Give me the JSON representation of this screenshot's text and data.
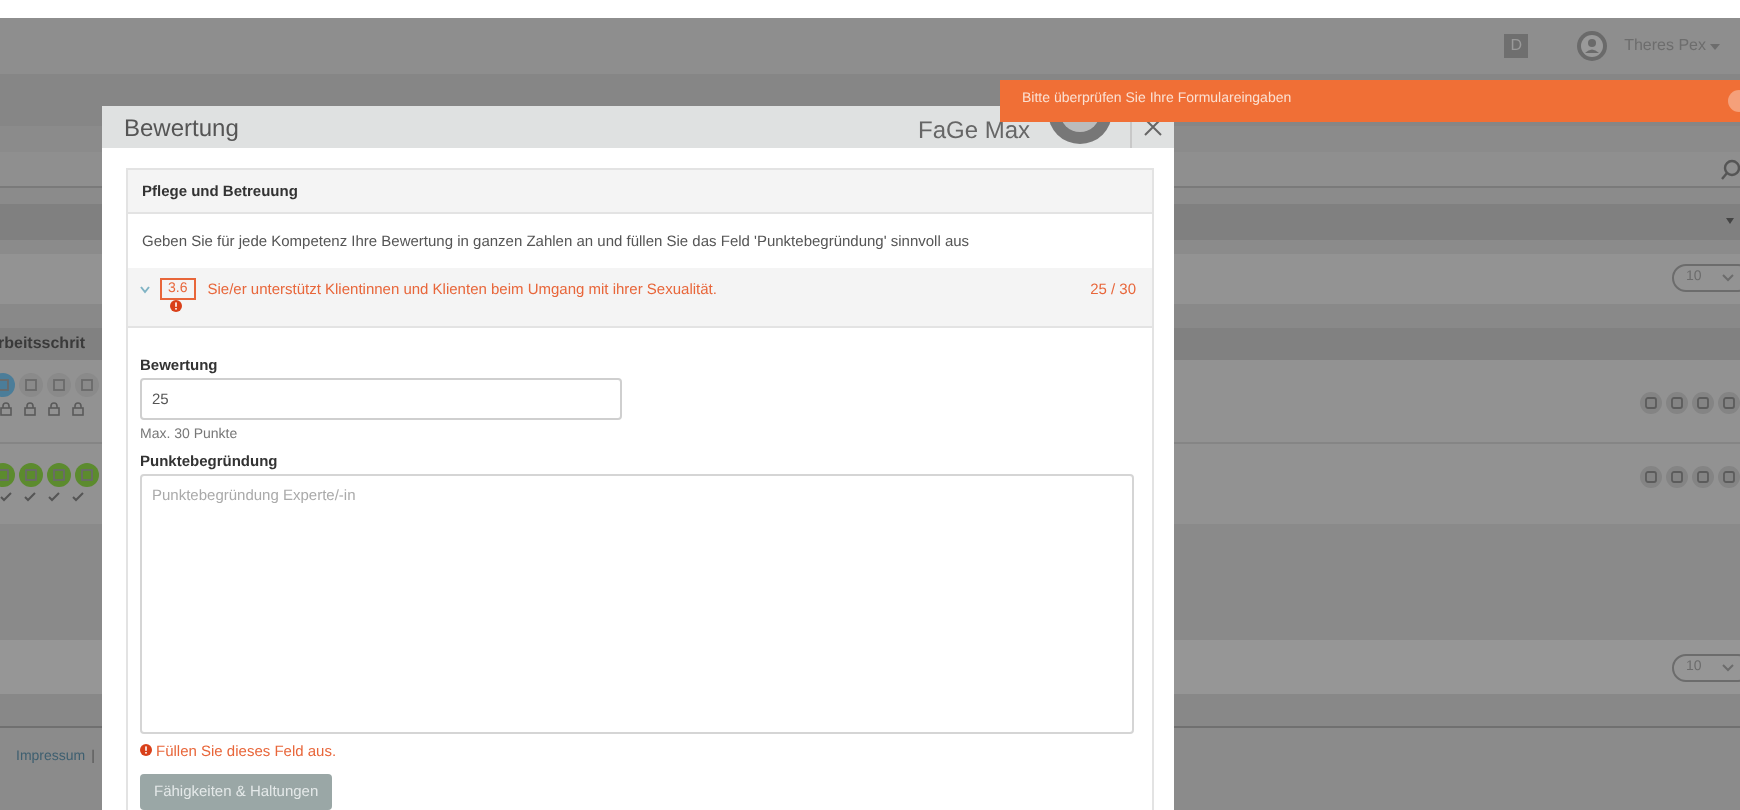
{
  "background": {
    "user_badge": "D",
    "user_name": "Theres Pex",
    "partial_heading": "rbeitsschrit",
    "footer_link": "Impressum",
    "footer_separator": "|",
    "page_size_selects": [
      "10",
      "10"
    ]
  },
  "toast": {
    "message": "Bitte überprüfen Sie Ihre Formulareingaben"
  },
  "modal": {
    "title": "Bewertung",
    "person": "FaGe Max",
    "panel": {
      "heading": "Pflege und Betreuung",
      "instruction": "Geben Sie für jede Kompetenz Ihre Bewertung in ganzen Zahlen an und füllen Sie das Feld 'Punktebegründung' sinnvoll aus",
      "competency": {
        "number": "3.6",
        "text": "Sie/er unterstützt Klientinnen und Klienten beim Umgang mit ihrer Sexualität.",
        "score": "25 / 30",
        "expanded": true,
        "error": true
      },
      "rating": {
        "label": "Bewertung",
        "value": "25",
        "hint": "Max. 30 Punkte"
      },
      "justification": {
        "label": "Punktebegründung",
        "placeholder": "Punktebegründung Experte/-in",
        "error": "Füllen Sie dieses Feld aus."
      },
      "button": {
        "label": "Fähigkeiten & Haltungen",
        "disabled": true
      }
    }
  }
}
